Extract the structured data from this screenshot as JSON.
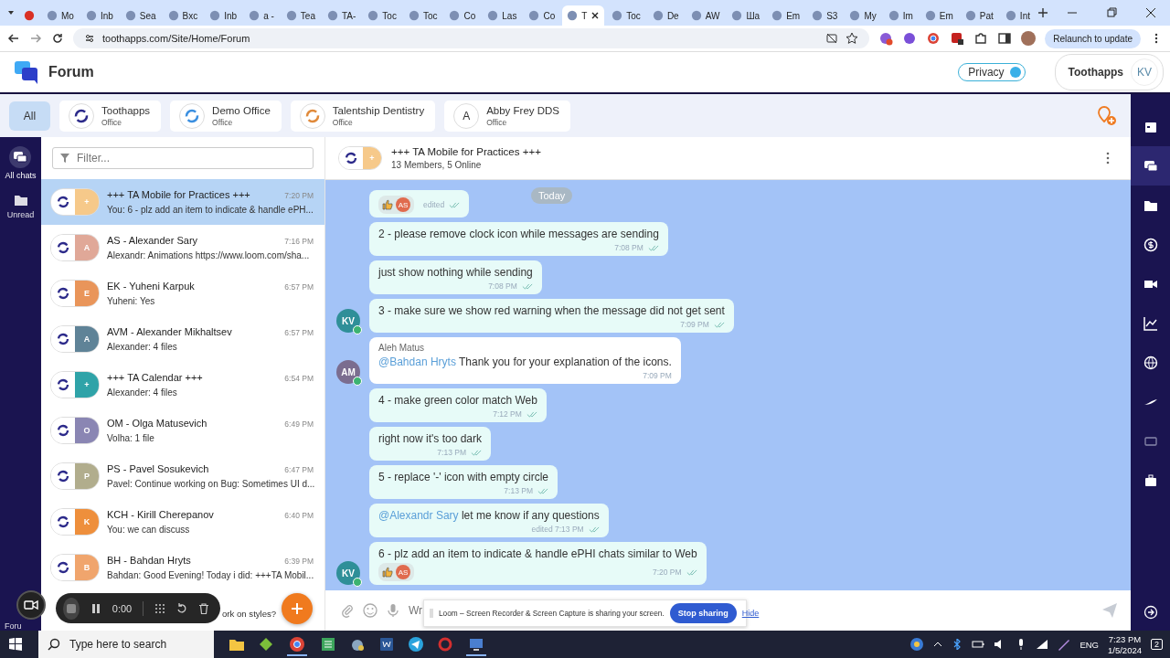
{
  "browser": {
    "tabs": [
      {
        "selected": false
      },
      {
        "label": "Mo",
        "selected": false
      },
      {
        "label": "Inb",
        "selected": false
      },
      {
        "label": "Sea",
        "selected": false
      },
      {
        "label": "Bxc",
        "selected": false
      },
      {
        "label": "Inb",
        "selected": false
      },
      {
        "label": "a -",
        "selected": false
      },
      {
        "label": "Tea",
        "selected": false
      },
      {
        "label": "TA-",
        "selected": false
      },
      {
        "label": "Toc",
        "selected": false
      },
      {
        "label": "Toc",
        "selected": false
      },
      {
        "label": "Co",
        "selected": false
      },
      {
        "label": "Las",
        "selected": false
      },
      {
        "label": "Co",
        "selected": false
      },
      {
        "label": "T",
        "selected": true
      },
      {
        "label": "Toc",
        "selected": false
      },
      {
        "label": "De",
        "selected": false
      },
      {
        "label": "AW",
        "selected": false
      },
      {
        "label": "Ша",
        "selected": false
      },
      {
        "label": "Em",
        "selected": false
      },
      {
        "label": "S3",
        "selected": false
      },
      {
        "label": "My",
        "selected": false
      },
      {
        "label": "Im",
        "selected": false
      },
      {
        "label": "Em",
        "selected": false
      },
      {
        "label": "Pat",
        "selected": false
      },
      {
        "label": "Int",
        "selected": false
      }
    ],
    "url": "toothapps.com/Site/Home/Forum",
    "update_button": "Relaunch to update"
  },
  "app": {
    "title": "Forum",
    "privacy": {
      "label": "Privacy",
      "on": true
    },
    "account": {
      "name": "Toothapps",
      "initials": "KV"
    }
  },
  "offices": [
    {
      "name": "All",
      "selected": true
    },
    {
      "name": "Toothapps",
      "sub": "Office",
      "selected": false
    },
    {
      "name": "Demo Office",
      "sub": "Office",
      "selected": false
    },
    {
      "name": "Talentship Dentistry",
      "sub": "Office",
      "selected": false
    },
    {
      "name": "Abby Frey DDS",
      "sub": "Office",
      "letter": "A",
      "selected": false
    }
  ],
  "nav": [
    {
      "label": "All chats",
      "selected": true
    },
    {
      "label": "Unread",
      "selected": false
    },
    {
      "label": "Foru",
      "selected": false
    }
  ],
  "filter": {
    "placeholder": "Filter..."
  },
  "chats": [
    {
      "name": "+++ TA Mobile for Practices +++",
      "time": "7:20 PM",
      "preview": "You: 6 - plz add an item to indicate & handle ePH...",
      "letter": "+",
      "color": "#f6c98a",
      "selected": true
    },
    {
      "name": "AS - Alexander Sary",
      "time": "7:16 PM",
      "preview": "Alexandr: Animations https://www.loom.com/sha...",
      "letter": "A",
      "color": "#e0a898",
      "selected": false
    },
    {
      "name": "EK - Yuheni Karpuk",
      "time": "6:57 PM",
      "preview": "Yuheni: Yes",
      "letter": "E",
      "color": "#e9955a",
      "selected": false
    },
    {
      "name": "AVM - Alexander Mikhaltsev",
      "time": "6:57 PM",
      "preview": "Alexander: 4 files",
      "letter": "A",
      "color": "#5f8397",
      "selected": false
    },
    {
      "name": "+++ TA Calendar +++",
      "time": "6:54 PM",
      "preview": "Alexander: 4 files",
      "letter": "+",
      "color": "#2fa3a8",
      "selected": false
    },
    {
      "name": "OM - Olga Matusevich",
      "time": "6:49 PM",
      "preview": "Volha: 1 file",
      "letter": "O",
      "color": "#8a86b3",
      "selected": false
    },
    {
      "name": "PS - Pavel Sosukevich",
      "time": "6:47 PM",
      "preview": "Pavel: Continue working on Bug: Sometimes UI d...",
      "letter": "P",
      "color": "#b1ad8d",
      "selected": false
    },
    {
      "name": "KCH - Kirill Cherepanov",
      "time": "6:40 PM",
      "preview": "You: we can discuss",
      "letter": "K",
      "color": "#ee8f3c",
      "selected": false
    },
    {
      "name": "BH - Bahdan Hryts",
      "time": "6:39 PM",
      "preview": "Bahdan: Good Evening! Today i did: +++TA Mobil...",
      "letter": "B",
      "color": "#f0a56d",
      "selected": false
    },
    {
      "preview": "ork on styles?",
      "selected": false
    }
  ],
  "conversation": {
    "title": "+++ TA Mobile for Practices +++",
    "subtitle": "13 Members, 5 Online",
    "letter": "+",
    "color": "#f6c98a",
    "day": "Today",
    "messages": [
      {
        "kind": "own",
        "reaction": "AS",
        "meta": "edited"
      },
      {
        "kind": "own",
        "text": "2 - please remove clock icon while messages are sending",
        "meta": "7:08 PM"
      },
      {
        "kind": "own",
        "text": "just show nothing while sending",
        "meta": "7:08 PM"
      },
      {
        "kind": "own",
        "text": "3 - make sure we show red warning when the message did not get sent",
        "meta": "7:09 PM",
        "avatar": {
          "initials": "KV",
          "color": "#2f8f98"
        }
      },
      {
        "kind": "other",
        "sender": "Aleh Matus",
        "mention": "@Bahdan Hryts",
        "text": "Thank you for your explanation of the icons.",
        "meta": "7:09 PM",
        "avatar": {
          "initials": "AM",
          "color": "#7b6d8f"
        }
      },
      {
        "kind": "own",
        "text": "4 - make green color match Web",
        "meta": "7:12 PM"
      },
      {
        "kind": "own",
        "text": "right now it's too dark",
        "meta": "7:13 PM"
      },
      {
        "kind": "own",
        "text": "5 - replace '-' icon with empty circle",
        "meta": "7:13 PM"
      },
      {
        "kind": "own",
        "mention": "@Alexandr Sary",
        "text": "let me know if any questions",
        "meta": "edited 7:13 PM"
      },
      {
        "kind": "own",
        "text": "6 - plz add an item to indicate & handle ePHI chats similar to Web",
        "reaction": "AS",
        "meta": "7:20 PM",
        "avatar": {
          "initials": "KV",
          "color": "#2f8f98"
        }
      }
    ],
    "composer": {
      "placeholder": "Wr"
    }
  },
  "recorder": {
    "timer": "0:00"
  },
  "sharing": {
    "message": "Loom – Screen Recorder & Screen Capture is sharing your screen.",
    "stop": "Stop sharing",
    "hide": "Hide"
  },
  "taskbar": {
    "search": "Type here to search",
    "language": "ENG",
    "time": "7:23 PM",
    "date": "1/5/2024",
    "notifications": "2"
  }
}
